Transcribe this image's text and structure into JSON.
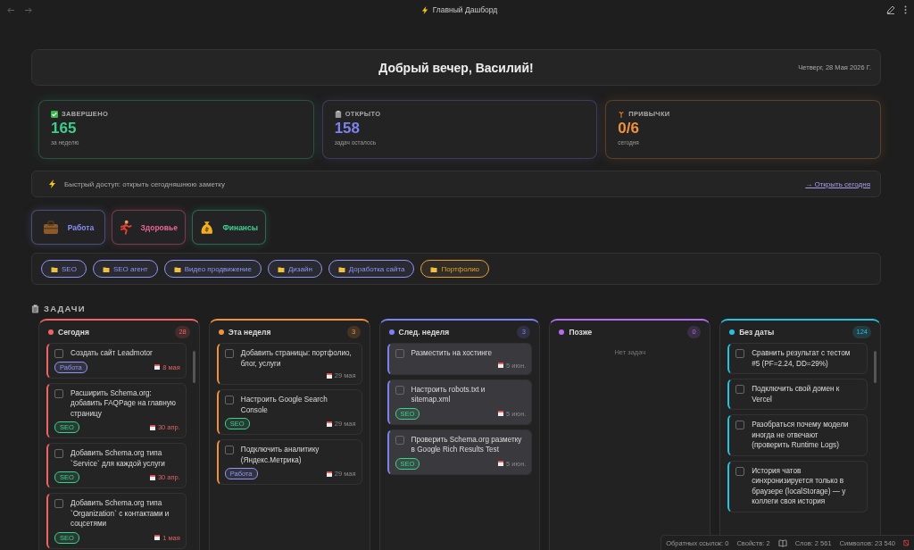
{
  "topbar": {
    "title": "Главный Дашборд"
  },
  "header": {
    "greeting": "Добрый вечер, Василий!",
    "date": "Четверг, 28 Мая 2026 Г."
  },
  "stats": [
    {
      "kind": "done",
      "label": "ЗАВЕРШЕНО",
      "value": "165",
      "caption": "за неделю",
      "color": "#3ecf8e"
    },
    {
      "kind": "open",
      "label": "ОТКРЫТО",
      "value": "158",
      "caption": "задач осталось",
      "color": "#7c83f0"
    },
    {
      "kind": "habits",
      "label": "ПРИВЫЧКИ",
      "value": "0/6",
      "caption": "сегодня",
      "color": "#f0913e"
    }
  ],
  "quick_access": {
    "text": "Быстрый доступ: открыть сегодняшнюю заметку",
    "link": "→ Открыть сегодня"
  },
  "categories": [
    {
      "kind": "work",
      "label": "Работа",
      "color": "#8a8ff5"
    },
    {
      "kind": "health",
      "label": "Здоровье",
      "color": "#e8668f"
    },
    {
      "kind": "finance",
      "label": "Финансы",
      "color": "#3ecf8e"
    }
  ],
  "folders": [
    {
      "label": "SEO",
      "color": "#8f95f0"
    },
    {
      "label": "SEO агент",
      "color": "#8f95f0"
    },
    {
      "label": "Видео продвижение",
      "color": "#8f95f0"
    },
    {
      "label": "Дизайн",
      "color": "#8f95f0"
    },
    {
      "label": "Доработка сайта",
      "color": "#8f95f0"
    },
    {
      "label": "Портфолио",
      "color": "#e0a040"
    }
  ],
  "tasks_section": {
    "title": "ЗАДАЧИ"
  },
  "columns": [
    {
      "title": "Сегодня",
      "count": "28",
      "color": "#f06464",
      "tasks": [
        {
          "title": "Создать сайт Leadmotor",
          "checked": false,
          "tag": {
            "label": "Работа",
            "color": "#8f95f0"
          },
          "date": "8 мая",
          "overdue": true
        },
        {
          "title": "Расширить Schema.org: добавить FAQPage на главную страницу",
          "checked": false,
          "tag": {
            "label": "SEO",
            "color": "#3ecf8e"
          },
          "date": "30 апр.",
          "overdue": true
        },
        {
          "title": "Добавить Schema.org типа `Service` для каждой услуги",
          "checked": false,
          "tag": {
            "label": "SEO",
            "color": "#3ecf8e"
          },
          "date": "30 апр.",
          "overdue": true
        },
        {
          "title": "Добавить Schema.org типа `Organization` с контактами и соцсетями",
          "checked": false,
          "tag": {
            "label": "SEO",
            "color": "#3ecf8e"
          },
          "date": "1 мая",
          "overdue": true
        }
      ]
    },
    {
      "title": "Эта неделя",
      "count": "3",
      "color": "#f0913e",
      "tasks": [
        {
          "title": "Добавить страницы: портфолио, блог, услуги",
          "checked": false,
          "date": "29 мая",
          "overdue": false
        },
        {
          "title": "Настроить Google Search Console",
          "checked": false,
          "tag": {
            "label": "SEO",
            "color": "#3ecf8e"
          },
          "date": "29 мая",
          "overdue": false
        },
        {
          "title": "Подключить аналитику (Яндекс.Метрика)",
          "checked": false,
          "tag": {
            "label": "Работа",
            "color": "#8f95f0"
          },
          "date": "29 мая",
          "overdue": false
        }
      ]
    },
    {
      "title": "След. неделя",
      "count": "3",
      "color": "#7c83f0",
      "tasks": [
        {
          "title": "Разместить на хостинге",
          "checked": false,
          "highlighted": true,
          "date": "5 июн.",
          "overdue": false
        },
        {
          "title": "Настроить robots.txt и sitemap.xml",
          "checked": false,
          "highlighted": true,
          "tag": {
            "label": "SEO",
            "color": "#3ecf8e"
          },
          "date": "5 июн.",
          "overdue": false
        },
        {
          "title": "Проверить Schema.org разметку в Google Rich Results Test",
          "checked": false,
          "highlighted": true,
          "tag": {
            "label": "SEO",
            "color": "#3ecf8e"
          },
          "date": "5 июн.",
          "overdue": false
        }
      ]
    },
    {
      "title": "Позже",
      "count": "0",
      "color": "#b46cf0",
      "empty_text": "Нет задач"
    },
    {
      "title": "Без даты",
      "count": "124",
      "color": "#22c4e0",
      "tasks": [
        {
          "title": "Сравнить результат с тестом #5 (PF=2.24, DD=29%)",
          "checked": false
        },
        {
          "title": "Подключить свой домен к Vercel",
          "checked": false
        },
        {
          "title": "Разобраться почему модели иногда не отвечают (проверить Runtime Logs)",
          "checked": false
        },
        {
          "title": "История чатов синхронизируется только в браузере (localStorage) — у коллеги своя история",
          "checked": false
        }
      ]
    }
  ],
  "status_bar": {
    "backlinks": "Обратных ссылок: 0",
    "properties": "Свойств: 2",
    "words": "Слов: 2 561",
    "chars": "Символов: 23 540"
  }
}
